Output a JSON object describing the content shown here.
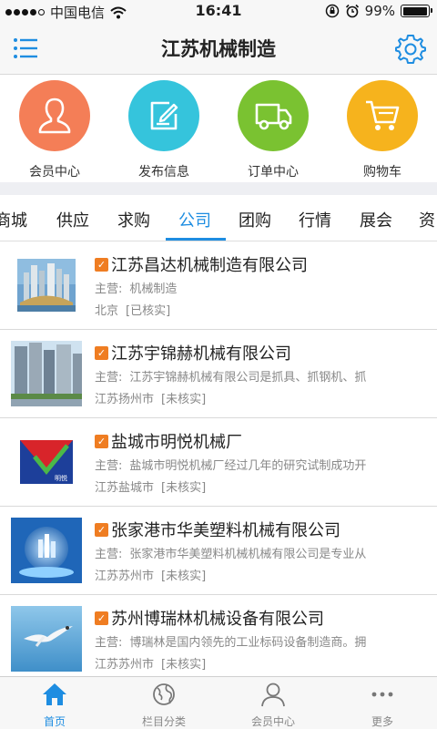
{
  "status_bar": {
    "carrier": "中国电信",
    "time": "16:41",
    "battery_percent": "99%",
    "battery_level": 0.99
  },
  "nav": {
    "title": "江苏机械制造"
  },
  "quick_actions": [
    {
      "label": "会员中心",
      "icon": "user-icon",
      "color": "#f47e57"
    },
    {
      "label": "发布信息",
      "icon": "edit-icon",
      "color": "#35c4dc"
    },
    {
      "label": "订单中心",
      "icon": "truck-icon",
      "color": "#7ac231"
    },
    {
      "label": "购物车",
      "icon": "cart-icon",
      "color": "#f6b31d"
    }
  ],
  "tabs": {
    "items": [
      "商城",
      "供应",
      "求购",
      "公司",
      "团购",
      "行情",
      "展会",
      "资"
    ],
    "active": "公司"
  },
  "companies": [
    {
      "name": "江苏昌达机械制造有限公司",
      "biz_prefix": "主营:",
      "biz": "机械制造",
      "city": "北京",
      "status": "[已核实]"
    },
    {
      "name": "江苏宇锦赫机械有限公司",
      "biz_prefix": "主营:",
      "biz": "江苏宇锦赫机械有限公司是抓具、抓钢机、抓",
      "city": "江苏扬州市",
      "status": "[未核实]"
    },
    {
      "name": "盐城市明悦机械厂",
      "biz_prefix": "主营:",
      "biz": "盐城市明悦机械厂经过几年的研究试制成功开",
      "city": "江苏盐城市",
      "status": "[未核实]",
      "logo_text": "明悦"
    },
    {
      "name": "张家港市华美塑料机械有限公司",
      "biz_prefix": "主营:",
      "biz": "张家港市华美塑料机械机械有限公司是专业从",
      "city": "江苏苏州市",
      "status": "[未核实]"
    },
    {
      "name": "苏州博瑞林机械设备有限公司",
      "biz_prefix": "主营:",
      "biz": "博瑞林是国内领先的工业标码设备制造商。拥",
      "city": "江苏苏州市",
      "status": "[未核实]"
    }
  ],
  "verified_mark": "✓",
  "tab_bar": [
    {
      "label": "首页",
      "icon": "home-icon",
      "active": true
    },
    {
      "label": "栏目分类",
      "icon": "globe-icon",
      "active": false
    },
    {
      "label": "会员中心",
      "icon": "person-icon",
      "active": false
    },
    {
      "label": "更多",
      "icon": "more-icon",
      "active": false
    }
  ],
  "colors": {
    "accent": "#1e8de1",
    "verified": "#ef7d22"
  }
}
